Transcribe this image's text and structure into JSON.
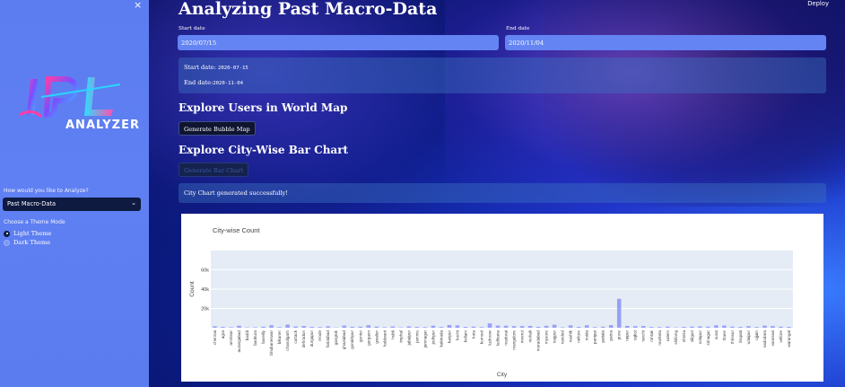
{
  "sidebar": {
    "close_glyph": "×",
    "logo": {
      "letters": "IPL",
      "word": "ANALYZER"
    },
    "analyze_label": "How would you like to Analyze?",
    "analyze_selected": "Past Macro-Data",
    "theme_label": "Choose a Theme Mode",
    "themes": [
      {
        "label": "Light Theme",
        "selected": true
      },
      {
        "label": "Dark Theme",
        "selected": false
      }
    ]
  },
  "header": {
    "deploy_label": "Deploy"
  },
  "main": {
    "title": "Analyzing Past Macro-Data",
    "start_date_label": "Start date",
    "start_date_value": "2020/07/15",
    "end_date_label": "End date",
    "end_date_value": "2020/11/04",
    "summary": {
      "start_prefix": "Start date:",
      "start_value": "2020-07-15",
      "end_prefix": "End date:",
      "end_value": "2020-11-04"
    },
    "world_map_heading": "Explore Users in World Map",
    "bubble_button": "Generate Bubble Map",
    "city_heading": "Explore City-Wise Bar Chart",
    "bar_button": "Generate Bar Chart",
    "success_message": "City Chart generated successfully!"
  },
  "colors": {
    "sidebar_bg": "#5f80f2",
    "input_bg": "#6384f2",
    "plot_bg": "#e5ecf6",
    "bar_color": "#636efa"
  },
  "chart_data": {
    "type": "bar",
    "title": "City-wise Count",
    "xlabel": "City",
    "ylabel": "Count",
    "ylim": [
      0,
      80000
    ],
    "yticks": [
      "20k",
      "40k",
      "60k"
    ],
    "categories": [
      "chennai",
      "agra",
      "amritsar",
      "aurangabad",
      "baddi",
      "bankura",
      "bareilly",
      "bhubaneswar",
      "bikaner",
      "chandigarh",
      "cuttack",
      "dehradun",
      "durgapur",
      "erode",
      "faridabad",
      "gangtok",
      "ghaziabad",
      "gorakhpur",
      "guntur",
      "gurgaon",
      "gwalior",
      "haldwani",
      "hubli",
      "imphal",
      "jabalpur",
      "jammu",
      "jamnagar",
      "jodhpur",
      "kakinada",
      "kanpur",
      "kochi",
      "kollam",
      "kota",
      "kurnool",
      "lucknow",
      "ludhiana",
      "madurai",
      "mangalore",
      "meerut",
      "mohali",
      "moradabad",
      "mysore",
      "nagpur",
      "nanded",
      "nashik",
      "nellore",
      "noida",
      "panipat",
      "patiala",
      "patna",
      "pune",
      "raipur",
      "rajkot",
      "ranchi",
      "rohtak",
      "rourkela",
      "salem",
      "shillong",
      "shimla",
      "siliguri",
      "solapur",
      "srinagar",
      "surat",
      "thane",
      "thrissur",
      "tirupati",
      "udaipur",
      "ujjain",
      "vadodara",
      "varanasi",
      "vellore",
      "warangal"
    ],
    "values": [
      1500,
      900,
      600,
      2100,
      400,
      500,
      1100,
      2600,
      700,
      3200,
      1300,
      1800,
      900,
      700,
      1500,
      300,
      2200,
      1000,
      1100,
      2600,
      1200,
      600,
      1300,
      400,
      1400,
      900,
      700,
      2100,
      800,
      2800,
      2400,
      900,
      1200,
      700,
      4500,
      2200,
      2100,
      1600,
      1700,
      1900,
      1000,
      2000,
      3100,
      500,
      2400,
      900,
      2600,
      700,
      1100,
      2700,
      30000,
      1900,
      1600,
      1800,
      800,
      700,
      1200,
      400,
      900,
      1200,
      1400,
      1100,
      2500,
      2300,
      1200,
      900,
      1600,
      800,
      2200,
      1700,
      1100,
      900
    ]
  }
}
